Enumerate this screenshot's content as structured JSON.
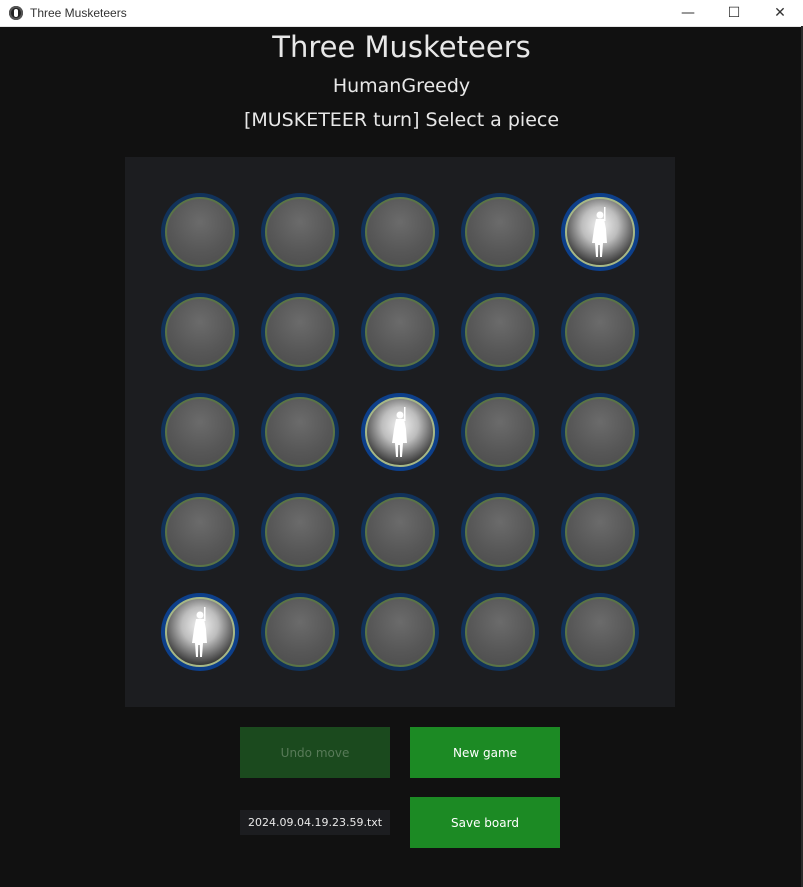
{
  "window": {
    "title": "Three Musketeers",
    "controls": {
      "minimize": "—",
      "maximize": "☐",
      "close": "✕"
    }
  },
  "header": {
    "title": "Three Musketeers",
    "player": "HumanGreedy",
    "status": "[MUSKETEER turn] Select a piece"
  },
  "board": {
    "size": 5,
    "cells": [
      [
        "empty",
        "empty",
        "empty",
        "empty",
        "musketeer"
      ],
      [
        "empty",
        "empty",
        "empty",
        "empty",
        "empty"
      ],
      [
        "empty",
        "empty",
        "musketeer",
        "empty",
        "empty"
      ],
      [
        "empty",
        "empty",
        "empty",
        "empty",
        "empty"
      ],
      [
        "musketeer",
        "empty",
        "empty",
        "empty",
        "empty"
      ]
    ]
  },
  "controls": {
    "undo_label": "Undo move",
    "new_game_label": "New game",
    "save_label": "Save board",
    "filename_value": "2024.09.04.19.23.59.txt"
  },
  "colors": {
    "background": "#111111",
    "board": "#1c1d20",
    "button_green": "#1c8a24",
    "button_disabled": "#1b4a1e",
    "piece_ring": "#11325a"
  }
}
